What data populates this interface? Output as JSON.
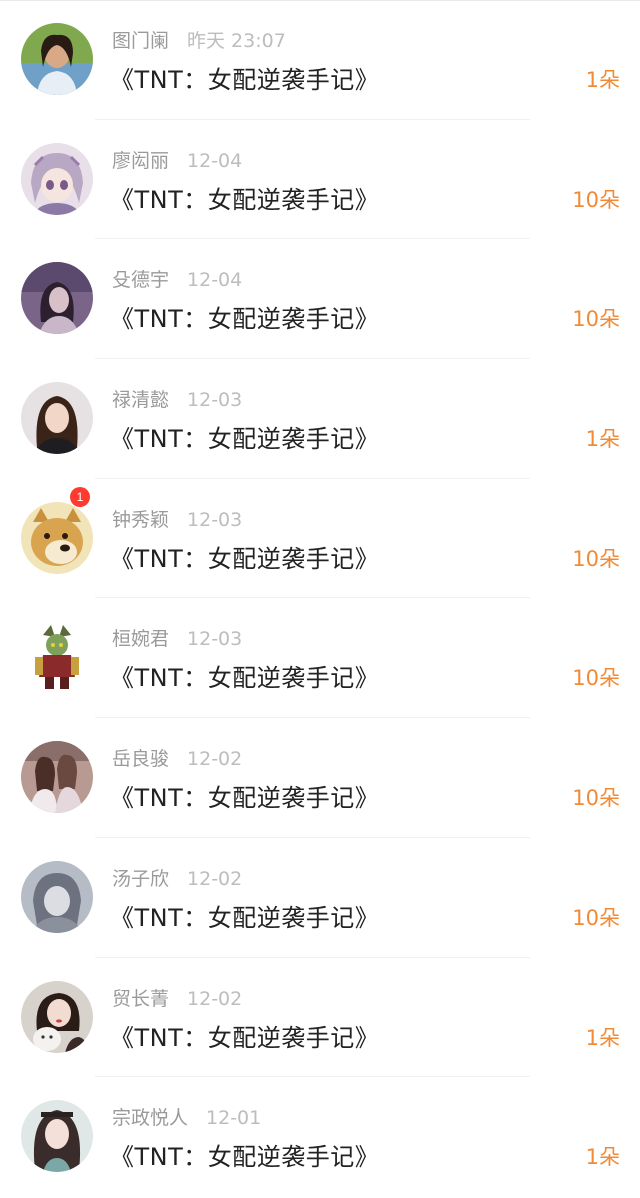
{
  "colors": {
    "name": "#9a9a9a",
    "time": "#bdbdbd",
    "title": "#222222",
    "gift": "#f28a35",
    "badge": "#ff3b30"
  },
  "items": [
    {
      "name": "图门阑",
      "time": "昨天 23:07",
      "title": "《TNT：女配逆袭手记》",
      "gift": "1朵",
      "avatar": "avatar-woman-outdoor"
    },
    {
      "name": "廖闳丽",
      "time": "12-04",
      "title": "《TNT：女配逆袭手记》",
      "gift": "10朵",
      "avatar": "avatar-anime-character"
    },
    {
      "name": "殳德宇",
      "time": "12-04",
      "title": "《TNT：女配逆袭手记》",
      "gift": "10朵",
      "avatar": "avatar-girl-purple"
    },
    {
      "name": "禄清懿",
      "time": "12-03",
      "title": "《TNT：女配逆袭手记》",
      "gift": "1朵",
      "avatar": "avatar-woman-portrait"
    },
    {
      "name": "钟秀颖",
      "time": "12-03",
      "title": "《TNT：女配逆袭手记》",
      "gift": "10朵",
      "avatar": "avatar-doge",
      "badge": "1"
    },
    {
      "name": "桓婉君",
      "time": "12-03",
      "title": "《TNT：女配逆袭手记》",
      "gift": "10朵",
      "avatar": "avatar-game-warrior"
    },
    {
      "name": "岳良骏",
      "time": "12-02",
      "title": "《TNT：女配逆袭手记》",
      "gift": "10朵",
      "avatar": "avatar-two-girls"
    },
    {
      "name": "汤子欣",
      "time": "12-02",
      "title": "《TNT：女配逆袭手记》",
      "gift": "10朵",
      "avatar": "avatar-grey-girl"
    },
    {
      "name": "贸长菁",
      "time": "12-02",
      "title": "《TNT：女配逆袭手记》",
      "gift": "1朵",
      "avatar": "avatar-girl-with-cat"
    },
    {
      "name": "宗政悦人",
      "time": "12-01",
      "title": "《TNT：女配逆袭手记》",
      "gift": "1朵",
      "avatar": "avatar-girl-long-hair"
    }
  ]
}
